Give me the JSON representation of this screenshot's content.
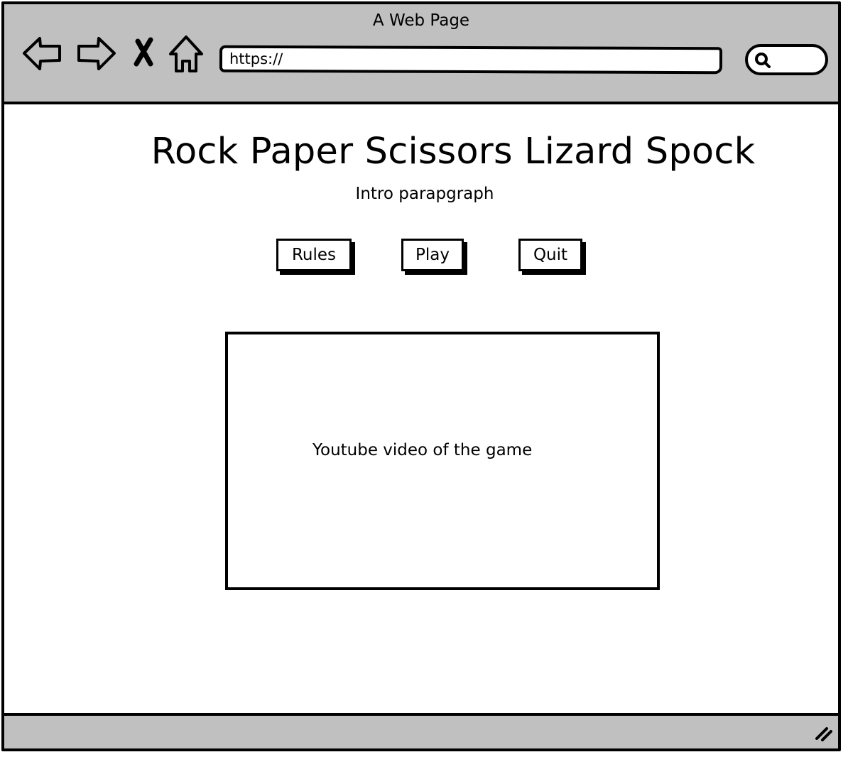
{
  "window": {
    "title": "A Web Page"
  },
  "toolbar": {
    "back_icon": "back-arrow-icon",
    "forward_icon": "forward-arrow-icon",
    "stop_icon": "close-icon",
    "home_icon": "home-icon",
    "url_value": "https://",
    "search_icon": "search-icon"
  },
  "page": {
    "title": "Rock Paper Scissors Lizard Spock",
    "intro": "Intro parapgraph",
    "buttons": {
      "rules": "Rules",
      "play": "Play",
      "quit": "Quit"
    },
    "video_placeholder": "Youtube video of the game"
  },
  "status_bar": {
    "resize_icon": "resize-grip-icon"
  },
  "colors": {
    "chrome": "#c0c0c0",
    "stroke": "#000000",
    "background": "#ffffff"
  }
}
